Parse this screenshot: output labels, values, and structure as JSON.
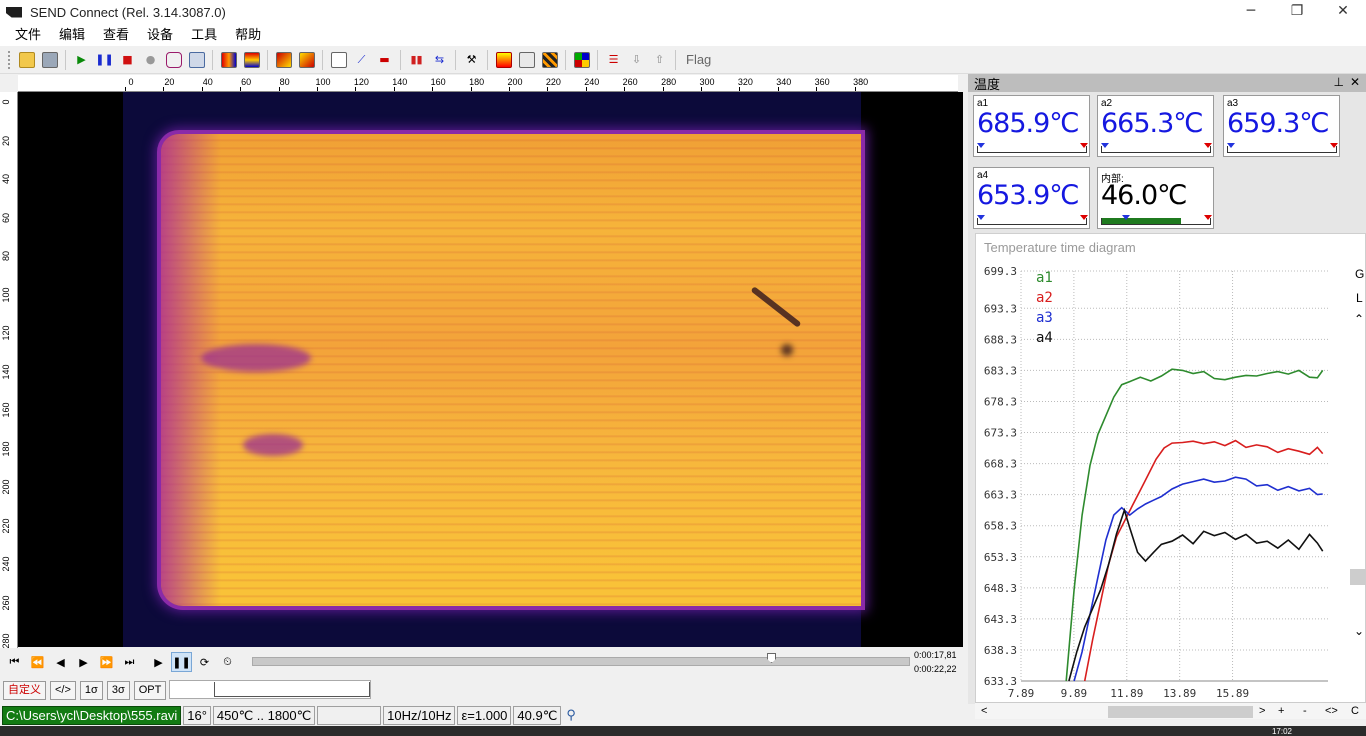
{
  "window": {
    "title": "SEND  Connect (Rel. 3.14.3087.0)",
    "minimize": "─",
    "maximize": "❐",
    "close": "✕"
  },
  "menu": [
    "文件",
    "编辑",
    "查看",
    "设备",
    "工具",
    "帮助"
  ],
  "toolbar": {
    "flag_label": "Flag"
  },
  "ruler": {
    "x_labels": [
      "0",
      "20",
      "40",
      "60",
      "80",
      "100",
      "120",
      "140",
      "160",
      "180",
      "200",
      "220",
      "240",
      "260",
      "280",
      "300",
      "320",
      "340",
      "360",
      "380"
    ],
    "y_labels": [
      "0",
      "20",
      "40",
      "60",
      "80",
      "100",
      "120",
      "140",
      "160",
      "180",
      "200",
      "220",
      "240",
      "260",
      "280"
    ]
  },
  "playback": {
    "time_current": "0:00:17,81",
    "time_total": "0:00:22,22",
    "position_fraction": 0.797
  },
  "opt_buttons": [
    "自定义",
    "</>",
    "1σ",
    "3σ",
    "OPT"
  ],
  "status": {
    "path": "C:\\Users\\ycl\\Desktop\\555.ravi",
    "angle": "16°",
    "range": "450℃ .. 1800℃",
    "blank": "",
    "rate": "10Hz/10Hz",
    "emissivity": "ε=1.000",
    "internal": "40.9℃"
  },
  "panel": {
    "title": "温度",
    "pin": "⊥",
    "close": "✕",
    "tiles": [
      {
        "label": "a1",
        "value": "685.9℃"
      },
      {
        "label": "a2",
        "value": "665.3℃"
      },
      {
        "label": "a3",
        "value": "659.3℃"
      },
      {
        "label": "a4",
        "value": "653.9℃"
      },
      {
        "label": "内部:",
        "value": "46.0℃",
        "fill_fraction": 0.72
      }
    ]
  },
  "chart_data": {
    "type": "line",
    "title": "Temperature time diagram",
    "ylim": [
      633.3,
      699.3
    ],
    "xlim": [
      7.89,
      19.5
    ],
    "y_ticks": [
      "699.3",
      "693.3",
      "688.3",
      "683.3",
      "678.3",
      "673.3",
      "668.3",
      "663.3",
      "658.3",
      "653.3",
      "648.3",
      "643.3",
      "638.3",
      "633.3"
    ],
    "x_ticks": [
      "7.89",
      "9.89",
      "11.89",
      "13.89",
      "15.89"
    ],
    "grid": true,
    "legend": "top-left",
    "series": [
      {
        "name": "a1",
        "color": "#2e8b2e",
        "x": [
          9.6,
          9.9,
          10.2,
          10.5,
          10.8,
          11.1,
          11.4,
          11.7,
          12.0,
          12.4,
          12.8,
          13.2,
          13.6,
          14.0,
          14.4,
          14.8,
          15.2,
          15.6,
          16.0,
          16.4,
          16.8,
          17.2,
          17.6,
          18.0,
          18.4,
          18.8,
          19.1,
          19.3
        ],
        "y": [
          633.3,
          648,
          660,
          668,
          673,
          676,
          679,
          681,
          681.5,
          682.2,
          681.6,
          682.4,
          683.5,
          683.3,
          682.8,
          683.1,
          682,
          681.8,
          682.2,
          682.5,
          682.4,
          682.8,
          683.1,
          682.7,
          683.3,
          682.2,
          682.1,
          683.3
        ]
      },
      {
        "name": "a2",
        "color": "#d81e1e",
        "x": [
          10.3,
          10.6,
          10.9,
          11.2,
          11.5,
          11.8,
          12.1,
          12.4,
          12.7,
          13.0,
          13.3,
          13.6,
          14.0,
          14.4,
          14.8,
          15.2,
          15.6,
          16.0,
          16.4,
          16.8,
          17.2,
          17.6,
          18.0,
          18.4,
          18.8,
          19.1,
          19.3
        ],
        "y": [
          633.3,
          640,
          646,
          652,
          656.5,
          659,
          661.5,
          664,
          666.5,
          669,
          670.8,
          671.6,
          671.7,
          671.9,
          671.5,
          671.8,
          671.2,
          672.0,
          670.9,
          671.3,
          671.0,
          670.1,
          670.7,
          670.3,
          669.8,
          670.9,
          669.9
        ]
      },
      {
        "name": "a3",
        "color": "#1f2fd0",
        "x": [
          9.9,
          10.2,
          10.5,
          10.8,
          11.1,
          11.4,
          11.7,
          12.0,
          12.3,
          12.6,
          12.9,
          13.2,
          13.6,
          14.0,
          14.4,
          14.8,
          15.2,
          15.6,
          16.0,
          16.4,
          16.8,
          17.2,
          17.6,
          18.0,
          18.4,
          18.8,
          19.1,
          19.3
        ],
        "y": [
          633.3,
          638,
          644,
          650,
          656,
          660,
          661.2,
          660.0,
          661.0,
          661.8,
          662.4,
          663.0,
          664.2,
          665.0,
          665.4,
          665.8,
          665.3,
          665.5,
          666.1,
          665.8,
          664.7,
          664.9,
          664.0,
          664.6,
          663.9,
          664.3,
          663.3,
          663.4
        ]
      },
      {
        "name": "a4",
        "color": "#111111",
        "x": [
          9.7,
          10.0,
          10.3,
          10.6,
          10.9,
          11.2,
          11.5,
          11.8,
          12.0,
          12.3,
          12.6,
          12.9,
          13.2,
          13.6,
          14.0,
          14.4,
          14.8,
          15.2,
          15.6,
          16.0,
          16.4,
          16.8,
          17.2,
          17.6,
          18.0,
          18.4,
          18.8,
          19.1,
          19.3
        ],
        "y": [
          633.3,
          638,
          642,
          645,
          648,
          652,
          657,
          660.8,
          658,
          654,
          652.6,
          654.0,
          655.3,
          655.8,
          656.8,
          655.4,
          657.4,
          656.7,
          657.2,
          656.1,
          656.9,
          655.5,
          655.8,
          654.7,
          656.0,
          654.5,
          656.9,
          655.5,
          654.2
        ]
      }
    ]
  },
  "chart_side": {
    "g": "G",
    "l": "L",
    "up": "⌃",
    "down": "⌄",
    "c": "C"
  },
  "hscroll": {
    "left": "<",
    "right": ">",
    "plus": "+",
    "minus": "-",
    "expand": "<>",
    "c": "C"
  },
  "taskbar": {
    "clock": "17:02"
  }
}
